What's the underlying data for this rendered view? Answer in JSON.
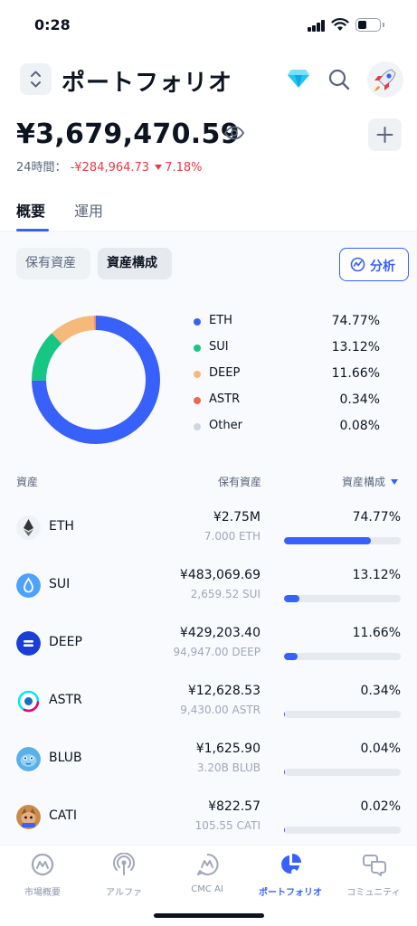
{
  "status": {
    "time": "0:28"
  },
  "header": {
    "title": "ポートフォリオ"
  },
  "portfolio": {
    "balance": "¥3,679,470.59",
    "change_label": "24時間：",
    "change_value": "-¥284,964.73",
    "change_pct": "7.18%"
  },
  "tabs": [
    {
      "label": "概要",
      "active": true
    },
    {
      "label": "運用",
      "active": false
    }
  ],
  "filters": {
    "holdings": "保有資産",
    "allocation": "資産構成",
    "analyze": "分析"
  },
  "legend": [
    {
      "name": "ETH",
      "pct": "74.77%",
      "color": "#3861fb"
    },
    {
      "name": "SUI",
      "pct": "13.12%",
      "color": "#16c784"
    },
    {
      "name": "DEEP",
      "pct": "11.66%",
      "color": "#f5b97a"
    },
    {
      "name": "ASTR",
      "pct": "0.34%",
      "color": "#ea6a4f"
    },
    {
      "name": "Other",
      "pct": "0.08%",
      "color": "#cfd6e4"
    }
  ],
  "chart_data": {
    "type": "pie",
    "categories": [
      "ETH",
      "SUI",
      "DEEP",
      "ASTR",
      "Other"
    ],
    "values": [
      74.77,
      13.12,
      11.66,
      0.34,
      0.08
    ],
    "colors": [
      "#3861fb",
      "#16c784",
      "#f5b97a",
      "#ea6a4f",
      "#cfd6e4"
    ]
  },
  "table": {
    "col_asset": "資産",
    "col_holdings": "保有資産",
    "col_allocation": "資産構成",
    "rows": [
      {
        "symbol": "ETH",
        "value": "¥2.75M",
        "amount": "7.000 ETH",
        "pct": "74.77%",
        "share": 74.77,
        "icon": "eth-icon"
      },
      {
        "symbol": "SUI",
        "value": "¥483,069.69",
        "amount": "2,659.52 SUI",
        "pct": "13.12%",
        "share": 13.12,
        "icon": "sui-icon"
      },
      {
        "symbol": "DEEP",
        "value": "¥429,203.40",
        "amount": "94,947.00 DEEP",
        "pct": "11.66%",
        "share": 11.66,
        "icon": "deep-icon"
      },
      {
        "symbol": "ASTR",
        "value": "¥12,628.53",
        "amount": "9,430.00 ASTR",
        "pct": "0.34%",
        "share": 0.34,
        "icon": "astr-icon"
      },
      {
        "symbol": "BLUB",
        "value": "¥1,625.90",
        "amount": "3.20B BLUB",
        "pct": "0.04%",
        "share": 0.04,
        "icon": "blub-icon"
      },
      {
        "symbol": "CATI",
        "value": "¥822.57",
        "amount": "105.55 CATI",
        "pct": "0.02%",
        "share": 0.02,
        "icon": "cati-icon"
      }
    ]
  },
  "nav": [
    {
      "label": "市場概要",
      "active": false
    },
    {
      "label": "アルファ",
      "active": false
    },
    {
      "label": "CMC AI",
      "active": false
    },
    {
      "label": "ポートフォリオ",
      "active": true
    },
    {
      "label": "コミュニティ",
      "active": false
    }
  ]
}
